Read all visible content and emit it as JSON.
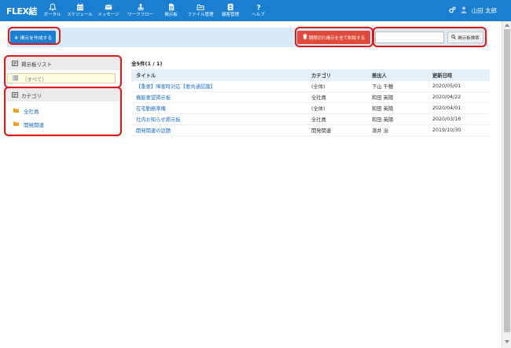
{
  "app": {
    "logo": "FLEX結"
  },
  "nav": {
    "items": [
      {
        "label": "ポータル",
        "icon": "bell-icon"
      },
      {
        "label": "スケジュール",
        "icon": "calendar-icon"
      },
      {
        "label": "メッセージ",
        "icon": "envelope-icon"
      },
      {
        "label": "ワークフロー",
        "icon": "stamp-icon"
      },
      {
        "label": "掲示板",
        "icon": "document-icon"
      },
      {
        "label": "ファイル管理",
        "icon": "folder-icon"
      },
      {
        "label": "顧客管理",
        "icon": "address-book-icon"
      },
      {
        "label": "ヘルプ",
        "icon": "question-icon"
      }
    ],
    "user_name": "山田 太郎"
  },
  "toolbar": {
    "create_label": "掲示を作成する",
    "delete_label": "期限切れ掲示を全て削除する",
    "search_placeholder": "",
    "search_value": "",
    "search_button_label": "掲示板検索"
  },
  "sidebar": {
    "board_list_title": "掲示板リスト",
    "all_label": "（すべて）",
    "category_title": "カテゴリ",
    "categories": [
      {
        "label": "全社員"
      },
      {
        "label": "開発関連"
      }
    ]
  },
  "main": {
    "count_label": "全5件(1 / 1)",
    "columns": {
      "title": "タイトル",
      "category": "カテゴリ",
      "sender": "差出人",
      "updated": "更新日時"
    },
    "rows": [
      {
        "title": "【重要】障害時対応【要共通認識】",
        "category": "(全体)",
        "sender": "下山 千穂",
        "updated": "2020/05/01"
      },
      {
        "title": "機能要望掲示板",
        "category": "全社員",
        "sender": "和田 英陽",
        "updated": "2020/04/22"
      },
      {
        "title": "在宅勤務準備",
        "category": "(全体)",
        "sender": "和田 英陽",
        "updated": "2020/04/01"
      },
      {
        "title": "社内お知らせ掲示板",
        "category": "全社員",
        "sender": "和田 英陽",
        "updated": "2020/03/16"
      },
      {
        "title": "開発関連の話題",
        "category": "開発関連",
        "sender": "濱井 治",
        "updated": "2019/10/30"
      }
    ]
  },
  "colors": {
    "nav_bg": "#1a7fd0",
    "toolbar_bg": "#d8e9f8",
    "delete_button": "#e04a3c",
    "link": "#1e6fc0",
    "highlight": "#e01818",
    "folder": "#f0a020"
  }
}
